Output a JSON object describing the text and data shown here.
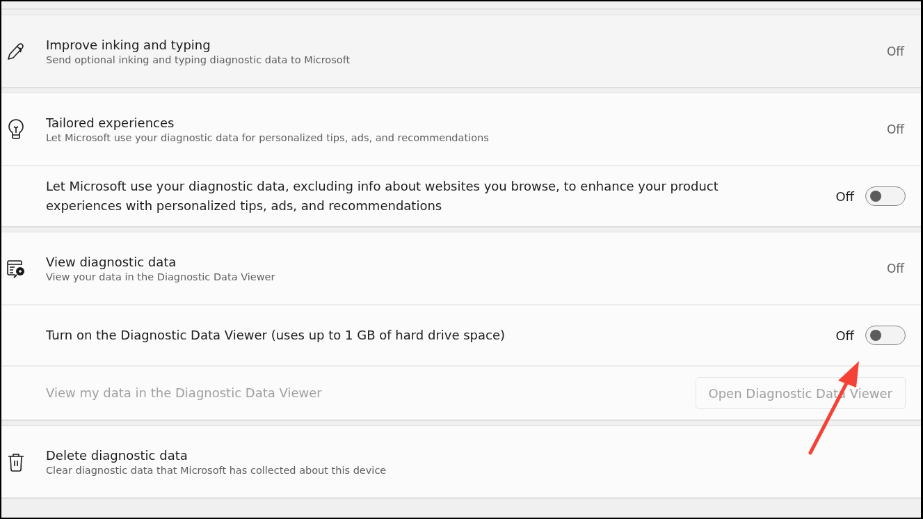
{
  "groups": [
    {
      "title": "Improve inking and typing",
      "subtitle": "Send optional inking and typing diagnostic data to Microsoft",
      "status": "Off"
    },
    {
      "title": "Tailored experiences",
      "subtitle": "Let Microsoft use your diagnostic data for personalized tips, ads, and recommendations",
      "status": "Off",
      "rows": [
        {
          "kind": "toggle",
          "label": "Let Microsoft use your diagnostic data, excluding info about websites you browse, to enhance your product experiences with personalized tips, ads, and recommendations",
          "state_label": "Off",
          "on": false
        }
      ]
    },
    {
      "title": "View diagnostic data",
      "subtitle": "View your data in the Diagnostic Data Viewer",
      "status": "Off",
      "rows": [
        {
          "kind": "toggle",
          "label": "Turn on the Diagnostic Data Viewer (uses up to 1 GB of hard drive space)",
          "state_label": "Off",
          "on": false
        },
        {
          "kind": "button",
          "label": "View my data in the Diagnostic Data Viewer",
          "button": "Open Diagnostic Data Viewer",
          "disabled": true
        }
      ]
    },
    {
      "title": "Delete diagnostic data",
      "subtitle": "Clear diagnostic data that Microsoft has collected about this device"
    }
  ]
}
